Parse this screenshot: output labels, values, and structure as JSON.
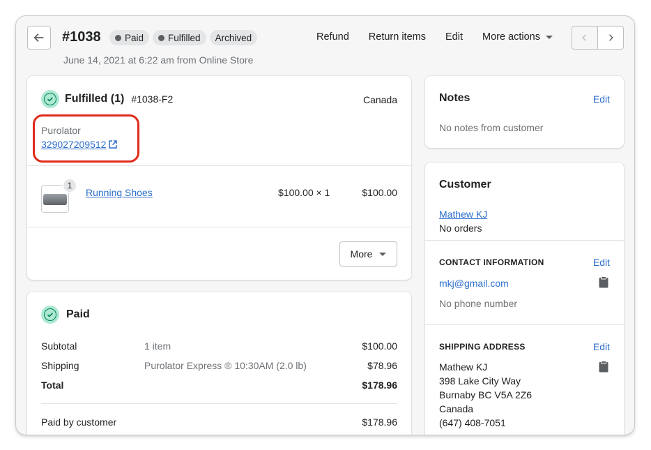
{
  "header": {
    "order_number": "#1038",
    "badges": [
      {
        "label": "Paid",
        "dot": true
      },
      {
        "label": "Fulfilled",
        "dot": true
      },
      {
        "label": "Archived",
        "dot": false
      }
    ],
    "actions": {
      "refund": "Refund",
      "return_items": "Return items",
      "edit": "Edit",
      "more_actions": "More actions"
    },
    "subtitle": "June 14, 2021 at 6:22 am from Online Store"
  },
  "fulfillment": {
    "title": "Fulfilled (1)",
    "fulfillment_id": "#1038-F2",
    "country": "Canada",
    "carrier": "Purolator",
    "tracking_number": "329027209512",
    "item": {
      "quantity": "1",
      "name": "Running Shoes",
      "unit_price": "$100.00 × 1",
      "total": "$100.00"
    },
    "more_label": "More"
  },
  "payment": {
    "title": "Paid",
    "subtotal": {
      "label": "Subtotal",
      "detail": "1 item",
      "amount": "$100.00"
    },
    "shipping": {
      "label": "Shipping",
      "detail": "Purolator Express ® 10:30AM (2.0 lb)",
      "amount": "$78.96"
    },
    "total": {
      "label": "Total",
      "amount": "$178.96"
    },
    "paid_by_customer": {
      "label": "Paid by customer",
      "amount": "$178.96"
    }
  },
  "notes": {
    "title": "Notes",
    "edit_label": "Edit",
    "text": "No notes from customer"
  },
  "customer": {
    "title": "Customer",
    "name": "Mathew KJ",
    "orders": "No orders",
    "contact": {
      "title": "CONTACT INFORMATION",
      "edit_label": "Edit",
      "email": "mkj@gmail.com",
      "phone": "No phone number"
    },
    "shipping_address": {
      "title": "SHIPPING ADDRESS",
      "edit_label": "Edit",
      "lines": [
        "Mathew KJ",
        "398 Lake City Way",
        "Burnaby BC V5A 2Z6",
        "Canada",
        "(647) 408-7051"
      ]
    }
  },
  "colors": {
    "link": "#2c6ecb",
    "success": "#007f5f",
    "success_bg": "#aee9d1",
    "highlight": "#e02a1a"
  }
}
